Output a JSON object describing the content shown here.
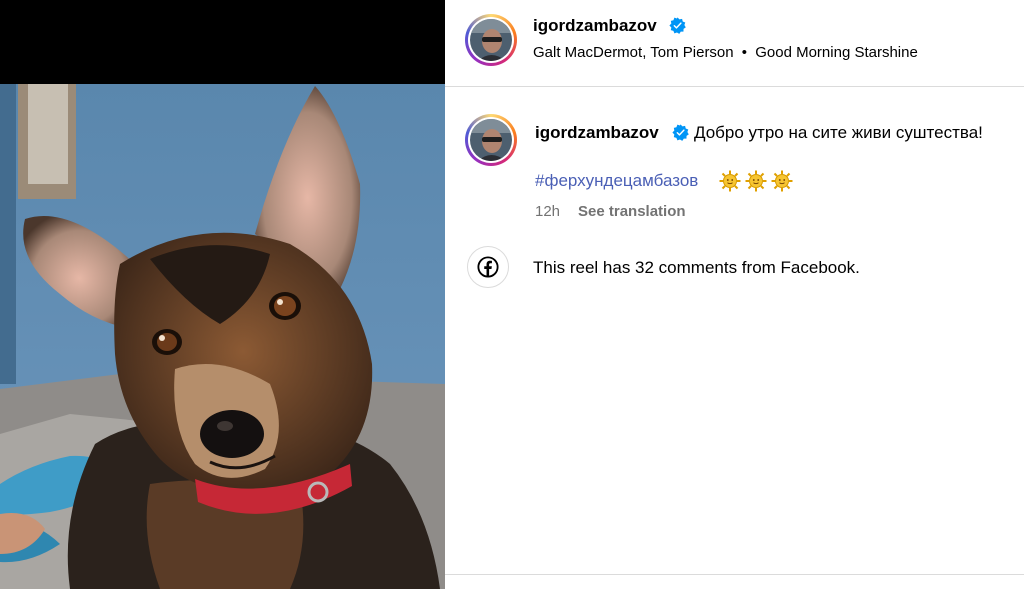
{
  "post": {
    "username": "igordzambazov",
    "verified": true,
    "audio": {
      "artists": "Galt MacDermot, Tom Pierson",
      "separator": "•",
      "song": "Good Morning Starshine"
    },
    "caption": {
      "username": "igordzambazov",
      "text": "Добро утро на сите живи суштества!",
      "hashtag": "#ферхундецамбазов",
      "emoji": [
        "sun-face-icon",
        "sun-face-icon",
        "sun-face-icon"
      ]
    },
    "time_ago": "12h",
    "see_translation_label": "See translation",
    "facebook_notice": "This reel has 32 comments from Facebook."
  },
  "colors": {
    "hashtag": "#4a5fb5",
    "verified_badge": "#0095f6",
    "muted_text": "#737373",
    "divider": "#dbdbdb"
  },
  "icons": {
    "media": "dog-photo",
    "verified": "verified-badge-icon",
    "facebook": "facebook-icon"
  }
}
